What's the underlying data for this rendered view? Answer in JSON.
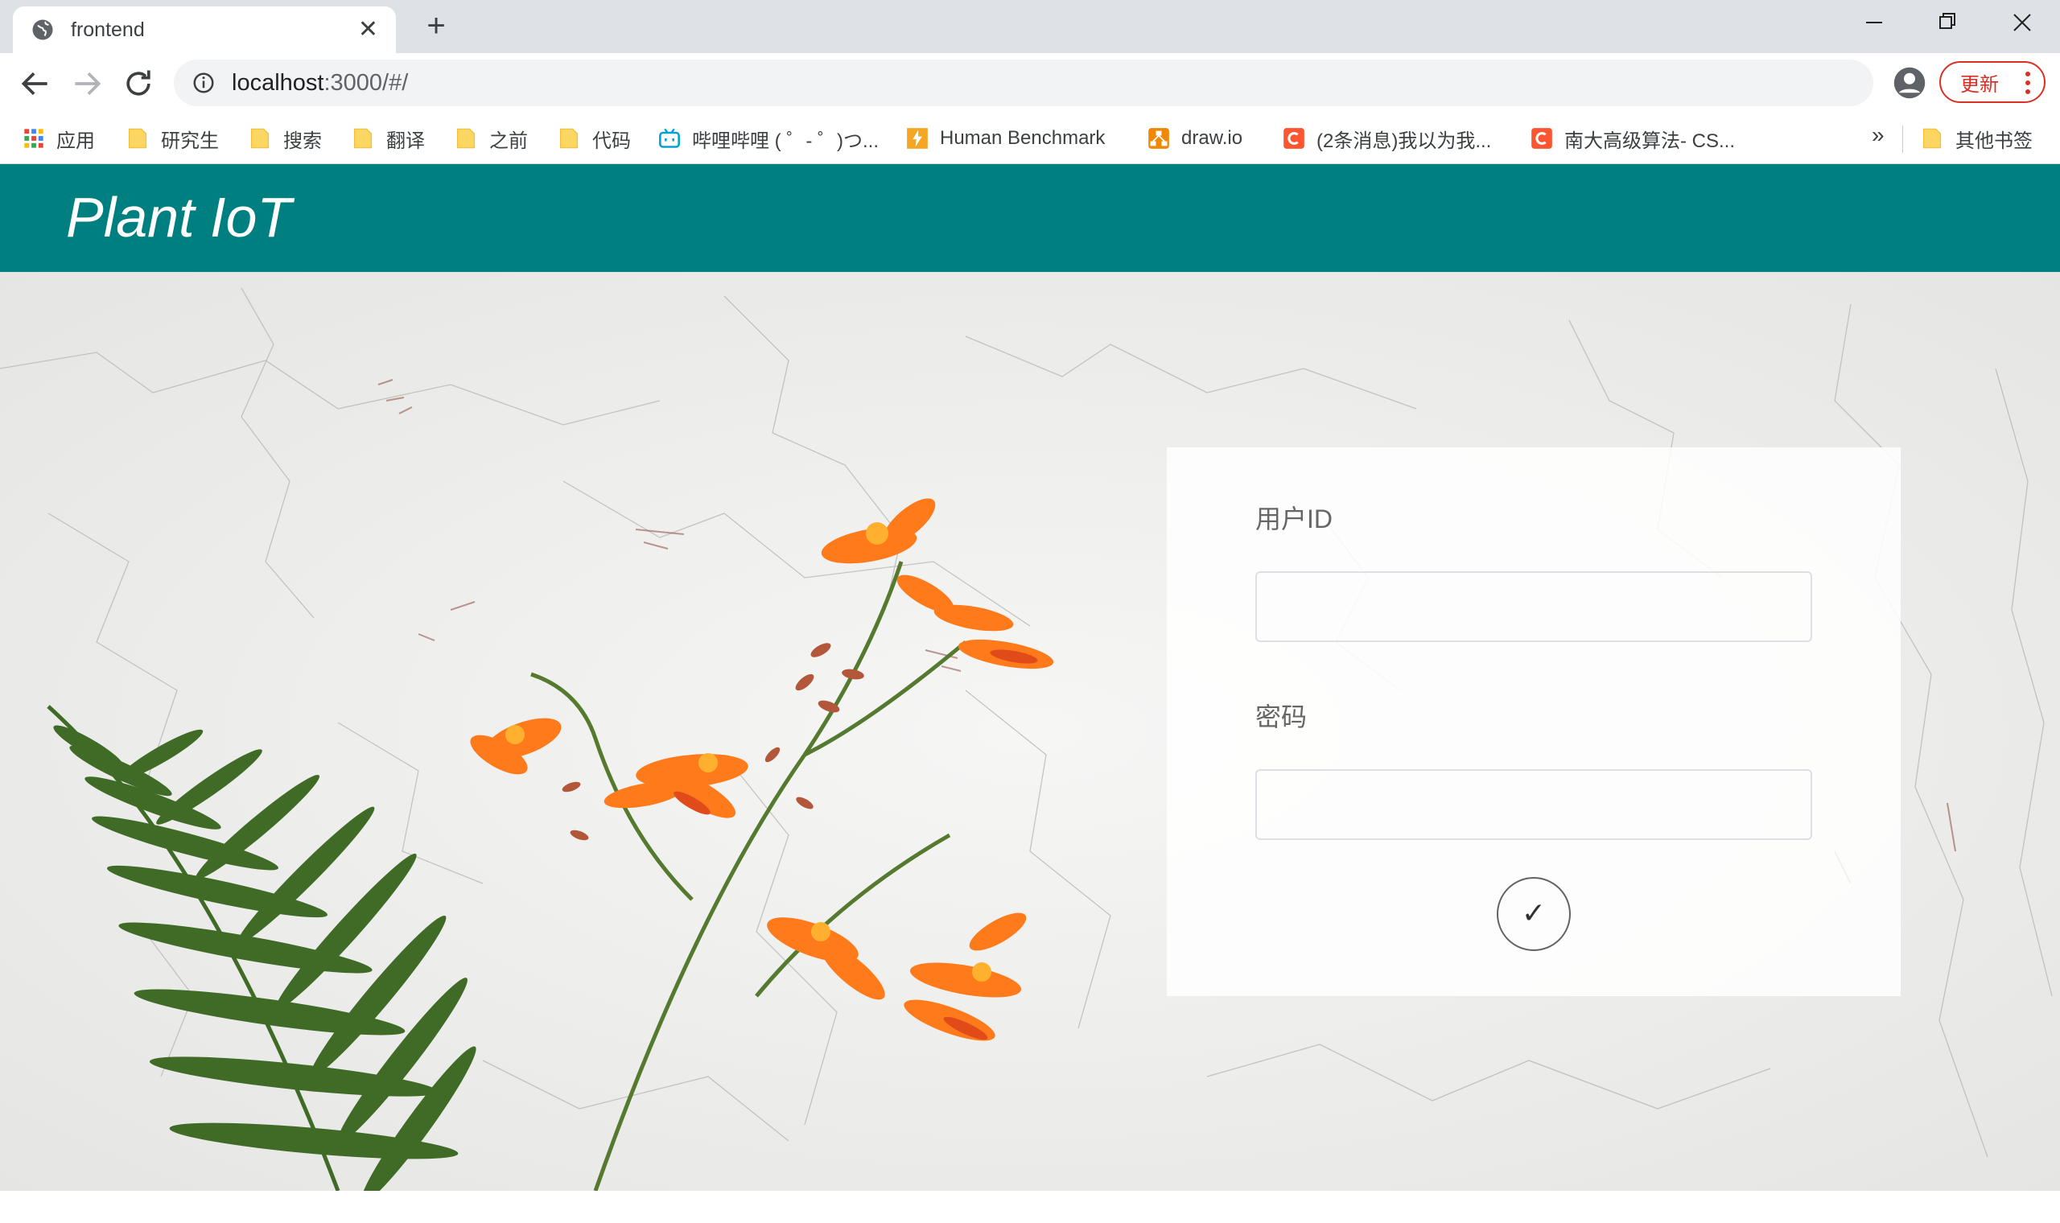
{
  "browser": {
    "tab_title": "frontend",
    "url_host": "localhost",
    "url_rest": ":3000/#/",
    "update_label": "更新",
    "bookmarks": [
      {
        "label": "应用",
        "icon": "apps-grid-icon"
      },
      {
        "label": "研究生",
        "icon": "folder-icon"
      },
      {
        "label": "搜索",
        "icon": "folder-icon"
      },
      {
        "label": "翻译",
        "icon": "folder-icon"
      },
      {
        "label": "之前",
        "icon": "folder-icon"
      },
      {
        "label": "代码",
        "icon": "folder-icon"
      },
      {
        "label": "哔哩哔哩 ( ゜- ゜)つ...",
        "icon": "bilibili-icon"
      },
      {
        "label": "Human Benchmark",
        "icon": "lightning-icon"
      },
      {
        "label": "draw.io",
        "icon": "drawio-icon"
      },
      {
        "label": "(2条消息)我以为我...",
        "icon": "csdn-icon"
      },
      {
        "label": "南大高级算法- CS...",
        "icon": "csdn-icon"
      }
    ],
    "more_bookmarks": "»",
    "other_bookmarks": "其他书签"
  },
  "page": {
    "brand": "Plant IoT",
    "login": {
      "user_label": "用户ID",
      "user_value": "",
      "password_label": "密码",
      "password_value": "",
      "submit_icon": "✓"
    }
  },
  "colors": {
    "header_bg": "#007f80",
    "update_red": "#d93025",
    "flower_orange": "#ff7a1a",
    "fern_green": "#3f6b26"
  }
}
